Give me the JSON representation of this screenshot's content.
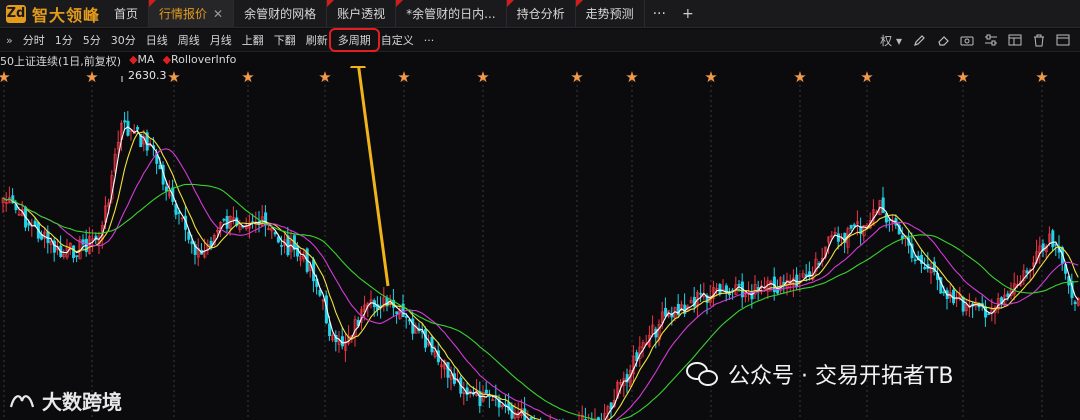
{
  "app": {
    "logo_mark": "Zd",
    "logo_text": "智大领峰"
  },
  "tabs": [
    {
      "label": "首页",
      "active": false,
      "flag": false,
      "close": false
    },
    {
      "label": "行情报价",
      "active": true,
      "flag": true,
      "close": true
    },
    {
      "label": "余管财的网格",
      "active": false,
      "flag": false,
      "close": false
    },
    {
      "label": "账户透视",
      "active": false,
      "flag": true,
      "close": false
    },
    {
      "label": "*余管财的日内...",
      "active": false,
      "flag": true,
      "close": false
    },
    {
      "label": "持仓分析",
      "active": false,
      "flag": true,
      "close": false
    },
    {
      "label": "走势预测",
      "active": false,
      "flag": true,
      "close": false
    }
  ],
  "tab_more": "···",
  "tab_add": "+",
  "toolbar": {
    "expand": "»",
    "items": [
      "分时",
      "1分",
      "5分",
      "30分",
      "日线",
      "周线",
      "月线",
      "上翻",
      "下翻",
      "刷新",
      "多周期",
      "自定义",
      "···"
    ],
    "highlighted": "多周期",
    "right_label": "权"
  },
  "info": {
    "symbol": "50上证连续(1日,前复权)",
    "ma": "MA",
    "rollover": "RolloverInfo",
    "high_price": "2630.3"
  },
  "watermarks": {
    "left": "大数跨境",
    "right": "公众号 · 交易开拓者TB"
  },
  "colors": {
    "up": "#f23645",
    "down": "#22d3e8",
    "ma1": "#ffffff",
    "ma2": "#f2e33d",
    "ma3": "#d23bd6",
    "ma4": "#39d12f",
    "star": "#f2994a",
    "annotation": "#f0b41a"
  },
  "chart_data": {
    "type": "candlestick",
    "high_label": 2630.3,
    "rollover_marker_count": 13,
    "ma_series": [
      "MA1",
      "MA2",
      "MA3",
      "MA4"
    ]
  }
}
